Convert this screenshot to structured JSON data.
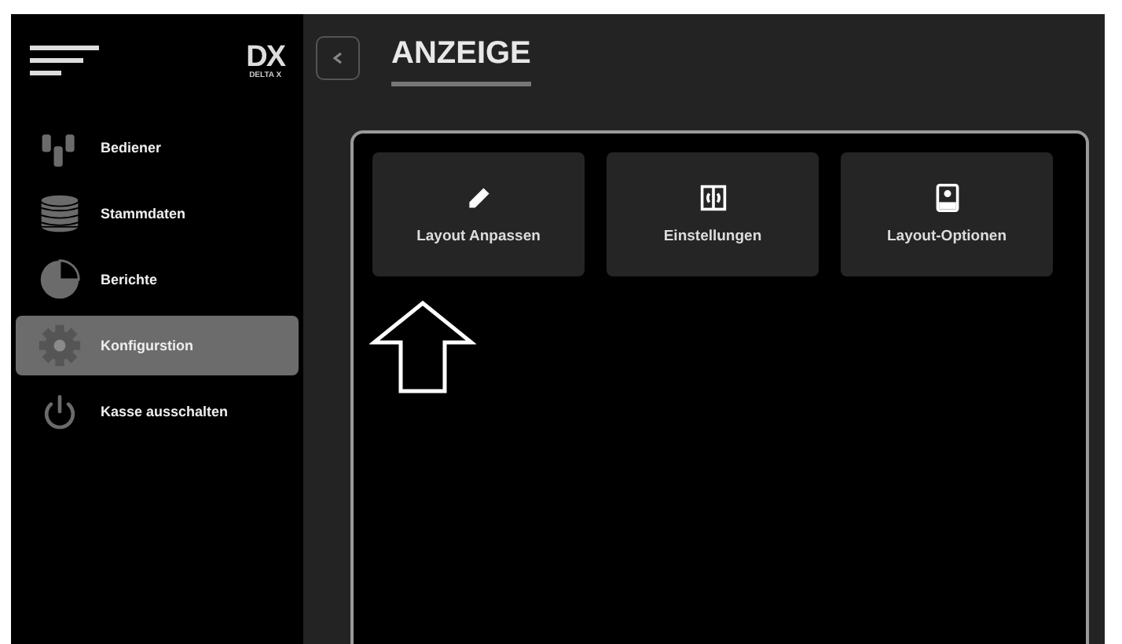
{
  "logo": {
    "mark": "DX",
    "subtitle": "DELTA X"
  },
  "sidebar": {
    "items": [
      {
        "label": "Bediener",
        "kind": "users",
        "selected": false
      },
      {
        "label": "Stammdaten",
        "kind": "database",
        "selected": false
      },
      {
        "label": "Berichte",
        "kind": "chart",
        "selected": false
      },
      {
        "label": "Konfigurstion",
        "kind": "gear",
        "selected": true
      },
      {
        "label": "Kasse ausschalten",
        "kind": "power",
        "selected": false
      }
    ]
  },
  "page": {
    "title": "ANZEIGE"
  },
  "tiles": [
    {
      "label": "Layout Anpassen",
      "kind": "pencil",
      "pointed": true
    },
    {
      "label": "Einstellungen",
      "kind": "columns",
      "pointed": false
    },
    {
      "label": "Layout-Optionen",
      "kind": "device",
      "pointed": false
    }
  ]
}
